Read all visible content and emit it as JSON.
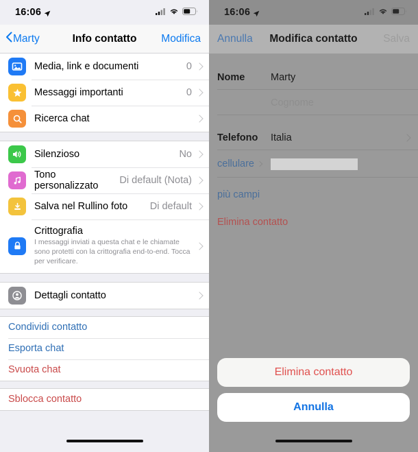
{
  "status_bar": {
    "time": "16:06",
    "location_icon": "location-arrow-icon",
    "cellular_icon": "cellular-bars-icon",
    "wifi_icon": "wifi-icon",
    "battery_icon": "battery-icon"
  },
  "left_screen": {
    "nav": {
      "back_label": "Marty",
      "title": "Info contatto",
      "action_label": "Modifica"
    },
    "group1": [
      {
        "icon": "media-photo-icon",
        "icon_color": "#1f7af5",
        "label": "Media, link e documenti",
        "value": "0",
        "chevron": true
      },
      {
        "icon": "star-icon",
        "icon_color": "#fac033",
        "label": "Messaggi importanti",
        "value": "0",
        "chevron": true
      },
      {
        "icon": "search-icon",
        "icon_color": "#f5903a",
        "label": "Ricerca chat",
        "value": "",
        "chevron": true
      }
    ],
    "group2": [
      {
        "icon": "speaker-icon",
        "icon_color": "#3cc84a",
        "label": "Silenzioso",
        "value": "No",
        "chevron": true
      },
      {
        "icon": "music-note-icon",
        "icon_color": "#e06bd0",
        "label": "Tono personalizzato",
        "value": "Di default (Nota)",
        "chevron": true
      },
      {
        "icon": "download-box-icon",
        "icon_color": "#f3c33c",
        "label": "Salva nel Rullino foto",
        "value": "Di default",
        "chevron": true
      }
    ],
    "encryption": {
      "icon": "lock-icon",
      "icon_color": "#1f7af5",
      "title": "Crittografia",
      "description": "I messaggi inviati a questa chat e le chiamate sono protetti con la crittografia end-to-end. Tocca per verificare.",
      "chevron": true
    },
    "group3": [
      {
        "icon": "contact-person-icon",
        "icon_color": "#8e8e93",
        "label": "Dettagli contatto",
        "value": "",
        "chevron": true
      }
    ],
    "actions": [
      {
        "label": "Condividi contatto",
        "style": "blue"
      },
      {
        "label": "Esporta chat",
        "style": "blue"
      },
      {
        "label": "Svuota chat",
        "style": "red"
      }
    ],
    "actions2": [
      {
        "label": "Sblocca contatto",
        "style": "red"
      }
    ]
  },
  "right_screen": {
    "nav": {
      "cancel_label": "Annulla",
      "title": "Modifica contatto",
      "save_label": "Salva"
    },
    "fields": [
      {
        "label": "Nome",
        "value": "Marty",
        "placeholder": "",
        "chevron": false
      },
      {
        "label": "",
        "value": "",
        "placeholder": "Cognome",
        "chevron": false
      },
      {
        "label": "Telefono",
        "value": "Italia",
        "placeholder": "",
        "chevron": true
      }
    ],
    "phone_row": {
      "label": "cellulare",
      "value_redacted": true
    },
    "more_fields_label": "più campi",
    "delete_contact_label": "Elimina contatto",
    "action_sheet": {
      "destructive_label": "Elimina contatto",
      "cancel_label": "Annulla"
    }
  }
}
